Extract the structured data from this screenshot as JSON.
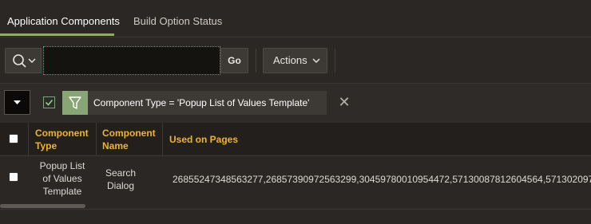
{
  "tabs": [
    {
      "label": "Application Components",
      "active": true
    },
    {
      "label": "Build Option Status",
      "active": false
    }
  ],
  "toolbar": {
    "search_icon": "search-icon",
    "search_value": "",
    "go_label": "Go",
    "actions_label": "Actions"
  },
  "filter": {
    "enabled": true,
    "text": "Component Type = 'Popup List of Values Template'"
  },
  "table": {
    "headers": {
      "component_type": [
        "Component",
        "Type"
      ],
      "component_name": [
        "Component",
        "Name"
      ],
      "used_on_pages": "Used on Pages"
    },
    "rows": [
      {
        "component_type": [
          "Popup List",
          "of Values",
          "Template"
        ],
        "component_name": [
          "Search",
          "Dialog"
        ],
        "used_on_pages": "26855247348563277,26857390972563299,30459780010954472,57130087812604564,571302097"
      }
    ]
  },
  "colors": {
    "accent_tab": "#8fa874",
    "header_text": "#f0b429",
    "filter_green": "#88a576",
    "focus_dotted": "#4fb48f"
  }
}
